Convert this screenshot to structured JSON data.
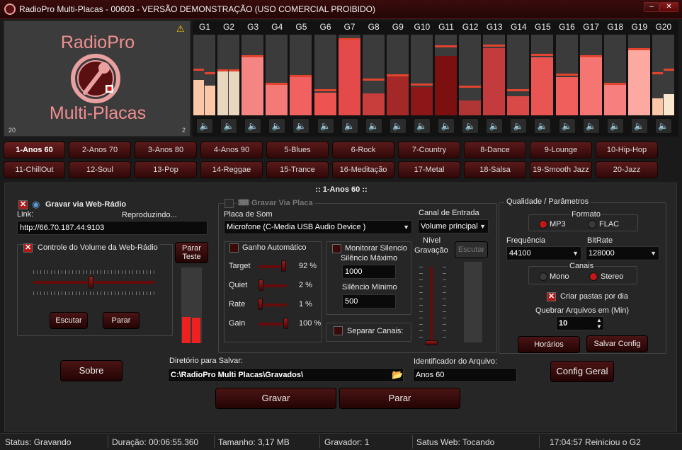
{
  "window": {
    "title": "RadioPro Multi-Placas - 00603 - VERSÃO DEMONSTRAÇÃO (USO COMERCIAL PROIBIDO)",
    "minimize": "‒",
    "close": "✕"
  },
  "logo": {
    "line1": "RadioPro",
    "line2": "Multi-Placas",
    "num_left": "20",
    "num_right": "2"
  },
  "meters": [
    {
      "label": "G1",
      "levels": [
        0.44,
        0.37
      ],
      "peaks": [
        0.55,
        0.51
      ],
      "colors": [
        "#fbc7a7",
        "#fbc7a7"
      ]
    },
    {
      "label": "G2",
      "levels": [
        0.54,
        0.54
      ],
      "peaks": [
        0.54,
        0.54
      ],
      "colors": [
        "#e8d6bf",
        "#e8d6bf"
      ]
    },
    {
      "label": "G3",
      "levels": [
        0.72
      ],
      "peaks": [
        0.72
      ],
      "colors": [
        "#f58583"
      ]
    },
    {
      "label": "G4",
      "levels": [
        0.38
      ],
      "peaks": [
        0.38
      ],
      "colors": [
        "#f47a78"
      ]
    },
    {
      "label": "G5",
      "levels": [
        0.47
      ],
      "peaks": [
        0.47
      ],
      "colors": [
        "#f0615f"
      ]
    },
    {
      "label": "G6",
      "levels": [
        0.28
      ],
      "peaks": [
        0.3
      ],
      "colors": [
        "#ec5351"
      ]
    },
    {
      "label": "G7",
      "levels": [
        0.93
      ],
      "peaks": [
        0.93
      ],
      "colors": [
        "#e44a49"
      ]
    },
    {
      "label": "G8",
      "levels": [
        0.27
      ],
      "peaks": [
        0.43
      ],
      "colors": [
        "#c83e3d"
      ]
    },
    {
      "label": "G9",
      "levels": [
        0.48
      ],
      "peaks": [
        0.48
      ],
      "colors": [
        "#a52829"
      ]
    },
    {
      "label": "G10",
      "levels": [
        0.35
      ],
      "peaks": [
        0.37
      ],
      "colors": [
        "#8c1718"
      ]
    },
    {
      "label": "G11",
      "levels": [
        0.74
      ],
      "peaks": [
        0.84
      ],
      "colors": [
        "#7c0f10"
      ]
    },
    {
      "label": "G12",
      "levels": [
        0.18
      ],
      "peaks": [
        0.34
      ],
      "colors": [
        "#b03636"
      ]
    },
    {
      "label": "G13",
      "levels": [
        0.83
      ],
      "peaks": [
        0.85
      ],
      "colors": [
        "#c33b3c"
      ]
    },
    {
      "label": "G14",
      "levels": [
        0.24
      ],
      "peaks": [
        0.3
      ],
      "colors": [
        "#d94948"
      ]
    },
    {
      "label": "G15",
      "levels": [
        0.72
      ],
      "peaks": [
        0.74
      ],
      "colors": [
        "#e95553"
      ]
    },
    {
      "label": "G16",
      "levels": [
        0.47
      ],
      "peaks": [
        0.49
      ],
      "colors": [
        "#f15f5d"
      ]
    },
    {
      "label": "G17",
      "levels": [
        0.72
      ],
      "peaks": [
        0.72
      ],
      "colors": [
        "#f57573"
      ]
    },
    {
      "label": "G18",
      "levels": [
        0.38
      ],
      "peaks": [
        0.38
      ],
      "colors": [
        "#f7807e"
      ]
    },
    {
      "label": "G19",
      "levels": [
        0.81
      ],
      "peaks": [
        0.81
      ],
      "colors": [
        "#fba9a1"
      ]
    },
    {
      "label": "G20",
      "levels": [
        0.21,
        0.26
      ],
      "peaks": [
        0.51,
        0.55
      ],
      "colors": [
        "#fbc7a7",
        "#f8e6cf"
      ]
    }
  ],
  "presets": [
    "1-Anos 60",
    "2-Anos 70",
    "3-Anos 80",
    "4-Anos 90",
    "5-Blues",
    "6-Rock",
    "7-Country",
    "8-Dance",
    "9-Lounge",
    "10-Hip-Hop",
    "11-ChillOut",
    "12-Soul",
    "13-Pop",
    "14-Reggae",
    "15-Trance",
    "16-Meditação",
    "17-Metal",
    "18-Salsa",
    "19-Smooth Jazz",
    "20-Jazz"
  ],
  "active_preset_index": 0,
  "main": {
    "title": ":: 1-Anos 60 ::",
    "web": {
      "title": "Gravar via Web-Rádio",
      "checked": true,
      "link_label": "Link:",
      "playing": "Reproduzindo...",
      "link_value": "http://66.70.187.44:9103",
      "volume_title": "Controle do Volume da Web-Rádio",
      "volume_checked": true,
      "volume_level": 0.47,
      "listen": "Escutar",
      "stop": "Parar",
      "test_line1": "Parar",
      "test_line2": "Teste",
      "vu_levels": [
        0.35,
        0.34
      ]
    },
    "card": {
      "title": "Gravar Via Placa",
      "checked": false,
      "sound_label": "Placa de Som",
      "sound_value": "Microfone (C-Media USB Audio Device   )",
      "auto_gain": "Ganho Automático",
      "rows": [
        {
          "label": "Target",
          "value": "92 %",
          "level": 0.92
        },
        {
          "label": "Quiet",
          "value": "2 %",
          "level": 0.02
        },
        {
          "label": "Rate",
          "value": "1 %",
          "level": 0.01
        },
        {
          "label": "Gain",
          "value": "100 %",
          "level": 1.0
        }
      ],
      "monitor": "Monitorar Silencio",
      "max_label": "Silêncio Máximo",
      "max_value": "1000",
      "min_label": "Silêncio Mínimo",
      "min_value": "500",
      "split": "Separar Canais:",
      "channel_label": "Canal de Entrada",
      "channel_value": "Volume principal",
      "rec_level_line1": "Nível",
      "rec_level_line2": "Gravação",
      "rec_level": 0.0,
      "listen": "Escutar"
    },
    "quality": {
      "title": "Qualidade / Parâmetros",
      "format_label": "Formato",
      "mp3": "MP3",
      "flac": "FLAC",
      "format_selected": "MP3",
      "freq_label": "Frequência",
      "freq_value": "44100",
      "bitrate_label": "BitRate",
      "bitrate_value": "128000",
      "channels_label": "Canais",
      "mono": "Mono",
      "stereo": "Stereo",
      "channels_selected": "Stereo",
      "folders": "Criar pastas por dia",
      "folders_checked": true,
      "split_label": "Quebrar Arquivos em (Min)",
      "split_value": "10",
      "schedule": "Horários",
      "save": "Salvar Config"
    },
    "dir_label": "Diretório para Salvar:",
    "dir_value": "C:\\RadioPro Multi Placas\\Gravados\\",
    "id_label": "Identificador do Arquivo:",
    "id_value": "Anos 60",
    "about": "Sobre",
    "config": "Config Geral",
    "record": "Gravar",
    "stop": "Parar"
  },
  "status": {
    "status": "Status: Gravando",
    "duration": "Duração: 00:06:55.360",
    "size": "Tamanho: 3,17 MB",
    "recorder": "Gravador: 1",
    "web": "Satus Web: Tocando",
    "event": "17:04:57 Reiniciou o G2"
  }
}
